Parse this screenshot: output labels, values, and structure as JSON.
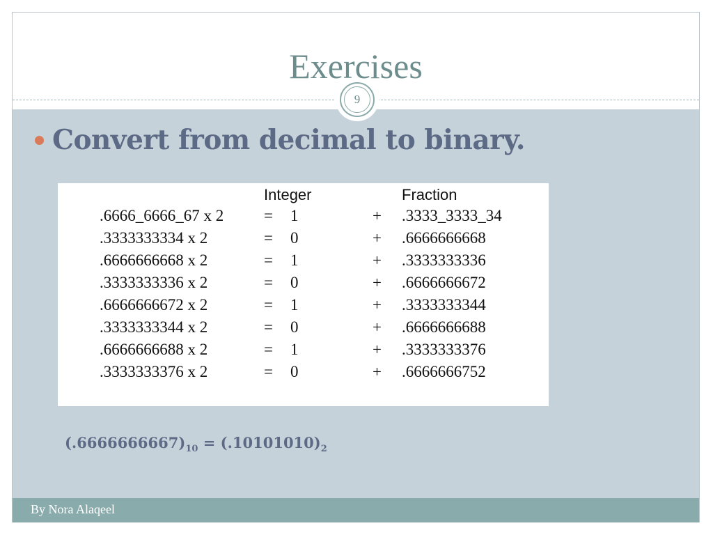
{
  "slide": {
    "title": "Exercises",
    "page_number": "9",
    "bullet": "Convert from decimal to binary.",
    "footer": "By Nora Alaqeel",
    "colors": {
      "title": "#6d8d8d",
      "content_background": "#c6d2d9",
      "bullet_dot": "#d97b5a",
      "body_text": "#5d6a86",
      "footer_bar": "#8aabab"
    }
  },
  "table": {
    "headers": {
      "integer": "Integer",
      "fraction": "Fraction"
    },
    "rows": [
      {
        "expr": ".6666_6666_67 x 2",
        "eq": "=",
        "int": "1",
        "plus": "+",
        "frac": ".3333_3333_34"
      },
      {
        "expr": ".3333333334 x 2",
        "eq": "=",
        "int": "0",
        "plus": "+",
        "frac": ".6666666668"
      },
      {
        "expr": ".6666666668 x 2",
        "eq": "=",
        "int": "1",
        "plus": "+",
        "frac": ".3333333336"
      },
      {
        "expr": ".3333333336 x 2",
        "eq": "=",
        "int": "0",
        "plus": "+",
        "frac": ".6666666672"
      },
      {
        "expr": ".6666666672 x 2",
        "eq": "=",
        "int": "1",
        "plus": "+",
        "frac": ".3333333344"
      },
      {
        "expr": ".3333333344 x 2",
        "eq": "=",
        "int": "0",
        "plus": "+",
        "frac": ".6666666688"
      },
      {
        "expr": ".6666666688 x 2",
        "eq": "=",
        "int": "1",
        "plus": "+",
        "frac": ".3333333376"
      },
      {
        "expr": ".3333333376 x 2",
        "eq": "=",
        "int": "0",
        "plus": "+",
        "frac": ".6666666752"
      }
    ]
  },
  "result": {
    "lhs": "(.6666666667)",
    "lhs_base": "10",
    "equals": "=",
    "rhs": "(.10101010)",
    "rhs_base": "2"
  }
}
